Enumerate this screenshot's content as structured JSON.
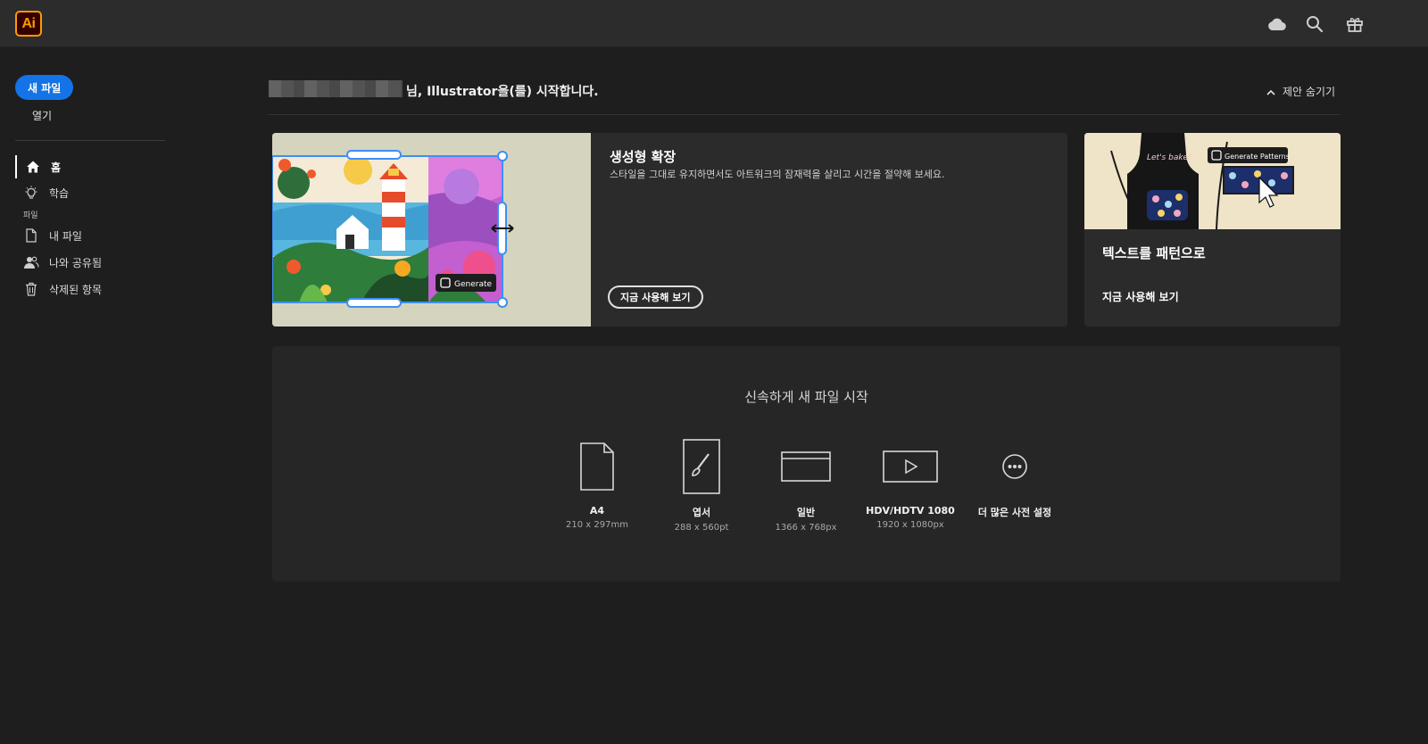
{
  "app": {
    "logo_text": "Ai"
  },
  "topbar": {
    "icons": [
      "cloud-icon",
      "search-icon",
      "gift-icon"
    ]
  },
  "sidebar": {
    "new_file": "새 파일",
    "open": "열기",
    "items": [
      {
        "label": "홈",
        "icon": "home-icon"
      },
      {
        "label": "학습",
        "icon": "lightbulb-icon"
      }
    ],
    "section_label": "파일",
    "file_items": [
      {
        "label": "내 파일",
        "icon": "file-icon"
      },
      {
        "label": "나와 공유됨",
        "icon": "people-icon"
      },
      {
        "label": "삭제된 항목",
        "icon": "trash-icon"
      }
    ]
  },
  "main": {
    "greeting": "님, Illustrator을(를) 시작합니다.",
    "hide_suggestions": "제안 숨기기",
    "card1": {
      "title": "생성형 확장",
      "desc": "스타일을 그대로 유지하면서도 아트워크의 잠재력을 살리고 시간을 절약해 보세요.",
      "button": "지금 사용해 보기",
      "art_badge": "Generate"
    },
    "card2": {
      "title": "텍스트를 패턴으로",
      "link": "지금 사용해 보기",
      "art_badge": "Generate Patterns",
      "art_text": "Let's bake!"
    },
    "quickstart": {
      "title": "신속하게 새 파일 시작",
      "presets": [
        {
          "name": "A4",
          "size": "210 x 297mm",
          "icon": "document-icon"
        },
        {
          "name": "엽서",
          "size": "288 x 560pt",
          "icon": "brush-card-icon"
        },
        {
          "name": "일반",
          "size": "1366 x 768px",
          "icon": "browser-window-icon"
        },
        {
          "name": "HDV/HDTV 1080",
          "size": "1920 x 1080px",
          "icon": "video-play-icon"
        },
        {
          "name": "더 많은 사전 설정",
          "size": "",
          "icon": "more-icon"
        }
      ]
    }
  },
  "colors": {
    "accent": "#1473e6",
    "background": "#1e1e1e",
    "topbar": "#2c2c2c",
    "card": "#2b2b2b",
    "logo": "#ff9a00"
  }
}
